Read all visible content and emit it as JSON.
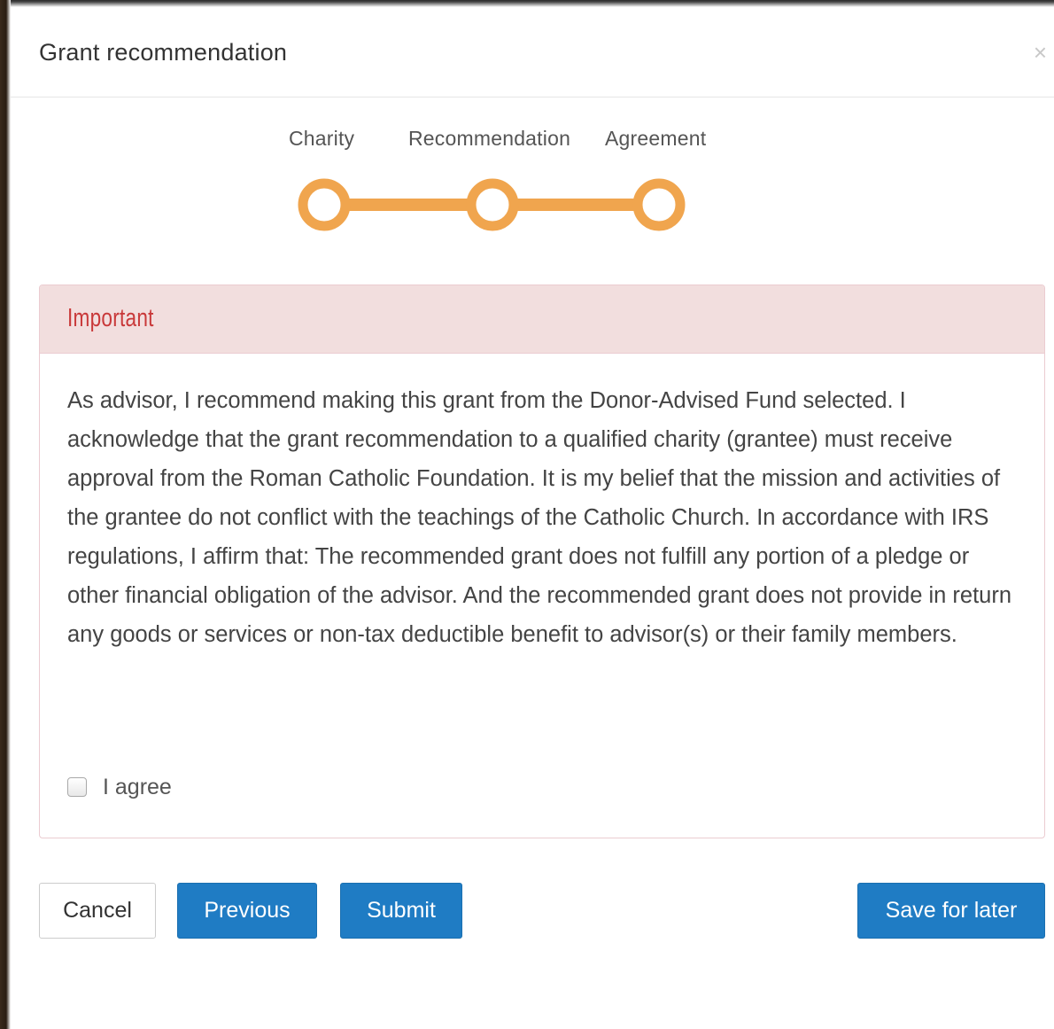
{
  "dialog": {
    "title": "Grant recommendation",
    "close_label": "×"
  },
  "steps": {
    "items": [
      {
        "label": "Charity"
      },
      {
        "label": "Recommendation"
      },
      {
        "label": "Agreement"
      }
    ],
    "color": "#f0a54e"
  },
  "panel": {
    "heading": "Important",
    "body": "As advisor, I recommend making this grant from the Donor-Advised Fund selected. I acknowledge that the grant recommendation to a qualified charity (grantee) must receive approval from the Roman Catholic Foundation. It is my belief that the mission and activities of the grantee do not conflict with the teachings of the Catholic Church. In accordance with IRS regulations, I affirm that: The recommended grant does not fulfill any portion of a pledge or other financial obligation of the advisor. And the recommended grant does not provide in return any goods or services or non-tax deductible benefit to advisor(s) or their family members.",
    "agree_label": "I agree",
    "agree_checked": false
  },
  "footer": {
    "cancel_label": "Cancel",
    "previous_label": "Previous",
    "submit_label": "Submit",
    "save_label": "Save for later"
  },
  "colors": {
    "primary": "#1f7cc4",
    "danger_text": "#c9393a",
    "danger_bg": "#f2dede",
    "step": "#f0a54e"
  }
}
